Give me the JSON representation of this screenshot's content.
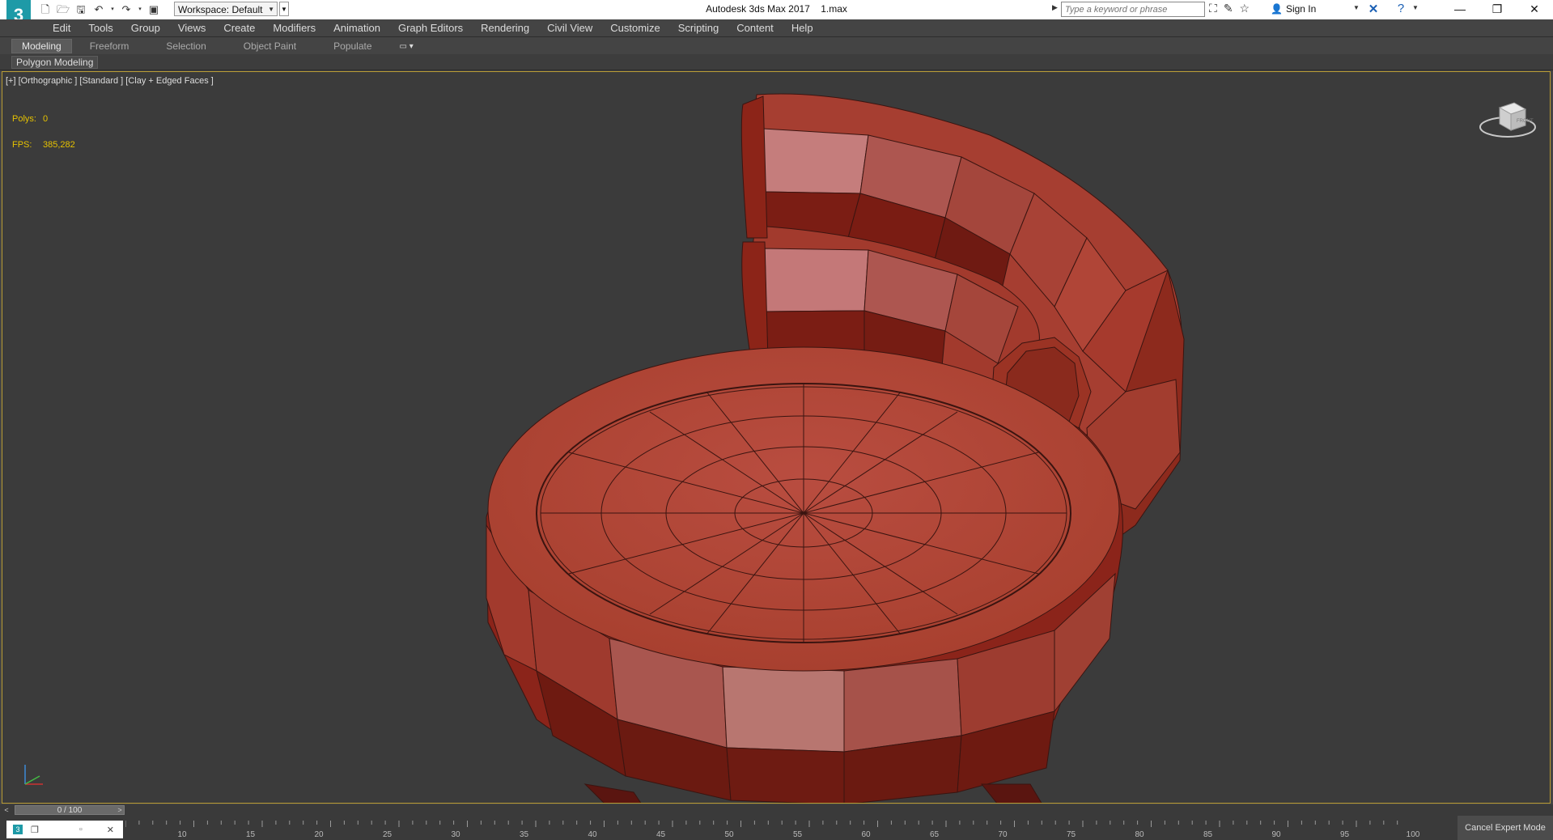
{
  "titlebar": {
    "logo": "3",
    "workspace": "Workspace: Default",
    "app_name": "Autodesk 3ds Max 2017",
    "file_name": "1.max",
    "search_placeholder": "Type a keyword or phrase",
    "sign_in": "Sign In",
    "icons": [
      "new-file-icon",
      "open-folder-icon",
      "save-icon",
      "undo-icon",
      "redo-icon",
      "project-icon"
    ]
  },
  "menu": [
    "Edit",
    "Tools",
    "Group",
    "Views",
    "Create",
    "Modifiers",
    "Animation",
    "Graph Editors",
    "Rendering",
    "Civil View",
    "Customize",
    "Scripting",
    "Content",
    "Help"
  ],
  "ribbon": {
    "tabs": [
      "Modeling",
      "Freeform",
      "Selection",
      "Object Paint",
      "Populate"
    ],
    "panel_label": "Polygon Modeling"
  },
  "viewport": {
    "label": "[+] [Orthographic ] [Standard ] [Clay + Edged Faces ]",
    "stats": {
      "polys_label": "Polys:",
      "polys_value": "0",
      "fps_label": "FPS:",
      "fps_value": "385,282"
    },
    "viewcube_face": "FRONT",
    "model_color": "#b8463a"
  },
  "timeline": {
    "frame": "0 / 100",
    "ticks": [
      "10",
      "15",
      "20",
      "25",
      "30",
      "35",
      "40",
      "45",
      "50",
      "55",
      "60",
      "65",
      "70",
      "75",
      "80",
      "85",
      "90",
      "95",
      "100"
    ]
  },
  "statusbar": {
    "cancel_expert": "Cancel Expert Mode"
  }
}
